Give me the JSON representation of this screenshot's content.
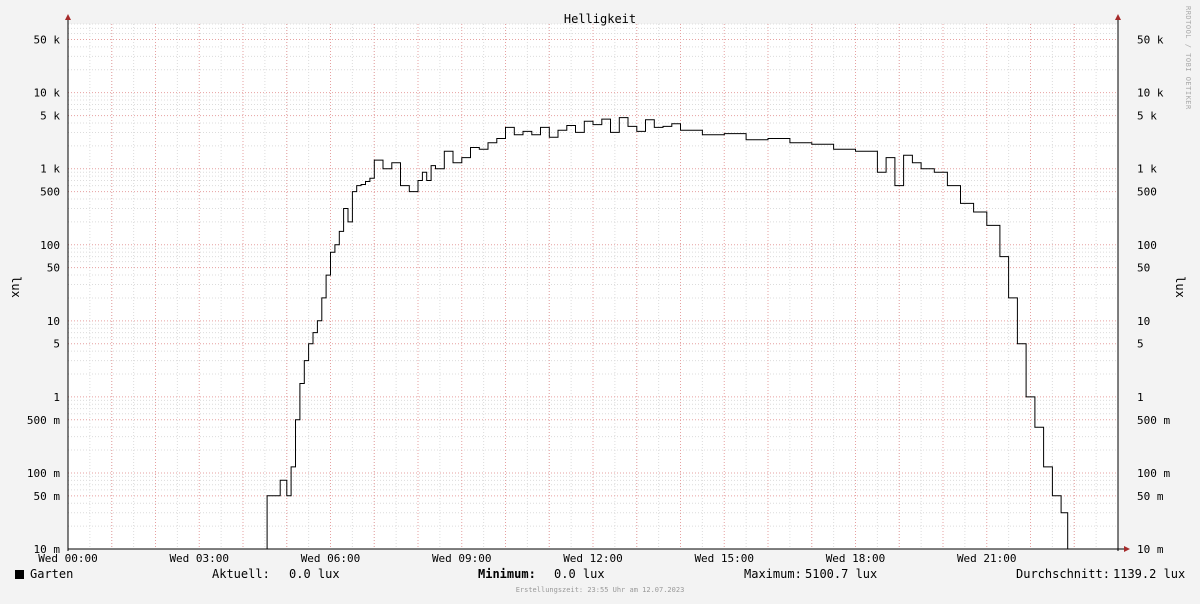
{
  "chart_data": {
    "type": "line",
    "title": "Helligkeit",
    "ylabel": "lux",
    "yscale": "log",
    "ylim": [
      0.01,
      80000
    ],
    "xlim": [
      0,
      24
    ],
    "grid": true,
    "y_ticks": [
      {
        "value": 0.01,
        "label": "10 m"
      },
      {
        "value": 0.05,
        "label": "50 m"
      },
      {
        "value": 0.1,
        "label": "100 m"
      },
      {
        "value": 0.5,
        "label": "500 m"
      },
      {
        "value": 1,
        "label": "1"
      },
      {
        "value": 5,
        "label": "5"
      },
      {
        "value": 10,
        "label": "10"
      },
      {
        "value": 50,
        "label": "50"
      },
      {
        "value": 100,
        "label": "100"
      },
      {
        "value": 500,
        "label": "500"
      },
      {
        "value": 1000,
        "label": "1 k"
      },
      {
        "value": 5000,
        "label": "5 k"
      },
      {
        "value": 10000,
        "label": "10 k"
      },
      {
        "value": 50000,
        "label": "50 k"
      }
    ],
    "x_ticks": [
      {
        "value": 0,
        "label": "Wed 00:00"
      },
      {
        "value": 3,
        "label": "Wed 03:00"
      },
      {
        "value": 6,
        "label": "Wed 06:00"
      },
      {
        "value": 9,
        "label": "Wed 09:00"
      },
      {
        "value": 12,
        "label": "Wed 12:00"
      },
      {
        "value": 15,
        "label": "Wed 15:00"
      },
      {
        "value": 18,
        "label": "Wed 18:00"
      },
      {
        "value": 21,
        "label": "Wed 21:00"
      }
    ],
    "series": [
      {
        "name": "Garten",
        "color": "#000000",
        "x": [
          0,
          4.5,
          4.55,
          4.75,
          4.85,
          5.0,
          5.1,
          5.2,
          5.3,
          5.4,
          5.5,
          5.6,
          5.7,
          5.8,
          5.9,
          6.0,
          6.1,
          6.2,
          6.3,
          6.4,
          6.5,
          6.6,
          6.7,
          6.8,
          6.9,
          7.0,
          7.2,
          7.4,
          7.6,
          7.8,
          8.0,
          8.1,
          8.2,
          8.3,
          8.4,
          8.6,
          8.8,
          9.0,
          9.2,
          9.4,
          9.6,
          9.8,
          10.0,
          10.2,
          10.4,
          10.6,
          10.8,
          11.0,
          11.2,
          11.4,
          11.6,
          11.8,
          12.0,
          12.2,
          12.4,
          12.6,
          12.8,
          13.0,
          13.2,
          13.4,
          13.6,
          13.8,
          14.0,
          14.5,
          15.0,
          15.5,
          16.0,
          16.5,
          17.0,
          17.5,
          18.0,
          18.5,
          18.7,
          18.9,
          19.1,
          19.3,
          19.5,
          19.8,
          20.1,
          20.4,
          20.7,
          21.0,
          21.3,
          21.5,
          21.7,
          21.9,
          22.1,
          22.3,
          22.5,
          22.7,
          22.85,
          23.0,
          23.01,
          24
        ],
        "values": [
          0.01,
          0.01,
          0.05,
          0.05,
          0.08,
          0.05,
          0.12,
          0.5,
          1.5,
          3,
          5,
          7,
          10,
          20,
          40,
          80,
          100,
          150,
          300,
          200,
          500,
          600,
          620,
          680,
          750,
          1300,
          1000,
          1200,
          600,
          500,
          700,
          900,
          700,
          1100,
          1000,
          1700,
          1200,
          1400,
          1900,
          1800,
          2200,
          2500,
          3500,
          2800,
          3100,
          2800,
          3500,
          2600,
          3200,
          3700,
          3000,
          4200,
          3800,
          4500,
          3000,
          4700,
          3600,
          3100,
          4400,
          3500,
          3600,
          3900,
          3200,
          2800,
          2900,
          2400,
          2500,
          2200,
          2100,
          1800,
          1700,
          900,
          1400,
          600,
          1500,
          1200,
          1000,
          900,
          600,
          350,
          270,
          180,
          70,
          20,
          5,
          1,
          0.4,
          0.12,
          0.05,
          0.03,
          0.01,
          0.01,
          0.01,
          0.01
        ]
      }
    ]
  },
  "legend": {
    "series_name": "Garten",
    "aktuell_label": "Aktuell:",
    "aktuell_value": "0.0 lux",
    "minimum_label": "Minimum:",
    "minimum_value": "0.0 lux",
    "maximum_label": "Maximum:",
    "maximum_value": "5100.7 lux",
    "durchschnitt_label": "Durchschnitt:",
    "durchschnitt_value": "1139.2 lux"
  },
  "footer": "Erstellungszeit: 23:55 Uhr am 12.07.2023",
  "watermark": "RRDTOOL / TOBI OETIKER",
  "colors": {
    "background": "#f3f3f3",
    "plot_background": "#ffffff",
    "major_grid": "#e6a0a0",
    "minor_grid": "#dcdcdc",
    "axis": "#a52a2a",
    "series": "#000000"
  }
}
